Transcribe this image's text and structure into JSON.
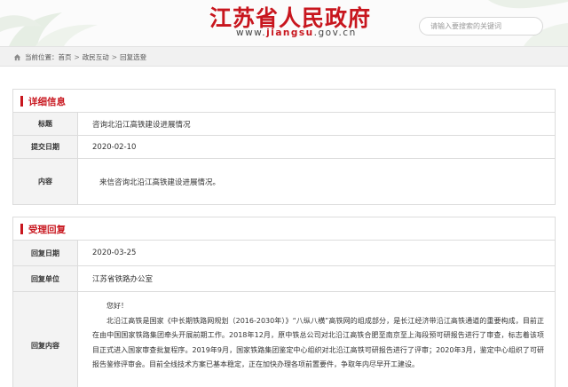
{
  "header": {
    "site_title": "江苏省人民政府",
    "url_prefix": "www.",
    "url_brand": "jiangsu",
    "url_suffix": ".gov.cn",
    "search_placeholder": "请输入要搜索的关键词"
  },
  "breadcrumb": {
    "lead": "当前位置：",
    "items": [
      "首页",
      "政民互动",
      "回复选登"
    ],
    "separator": ">"
  },
  "detail": {
    "section_title": "详细信息",
    "rows": [
      {
        "label": "标题",
        "value": "咨询北沿江高铁建设进展情况"
      },
      {
        "label": "提交日期",
        "value": "2020-02-10"
      },
      {
        "label": "内容",
        "value": "来信咨询北沿江高铁建设进展情况。"
      }
    ]
  },
  "reply": {
    "section_title": "受理回复",
    "date_label": "回复日期",
    "date_value": "2020-03-25",
    "unit_label": "回复单位",
    "unit_value": "江苏省铁路办公室",
    "content_label": "回复内容",
    "greeting": "您好！",
    "body": "北沿江高铁是国家《中长期铁路网规划（2016-2030年）》“八纵八横”高铁网的组成部分，是长江经济带沿江高铁通道的重要构成，目前正在由中国国家铁路集团牵头开展前期工作。2018年12月，原中铁总公司对北沿江高铁合肥至南京至上海段预可研报告进行了审查，标志着该项目正式进入国家审查批复程序。2019年9月，国家铁路集团鉴定中心组织对北沿江高铁可研报告进行了评审；2020年3月，鉴定中心组织了可研报告鉴修评审会。目前全线技术方案已基本稳定，正在加快办理各项前置要件，争取年内尽早开工建设。"
  },
  "colors": {
    "brand_red": "#c8161e",
    "label_bg": "#f3f3f3",
    "border": "#dcdcdc"
  }
}
